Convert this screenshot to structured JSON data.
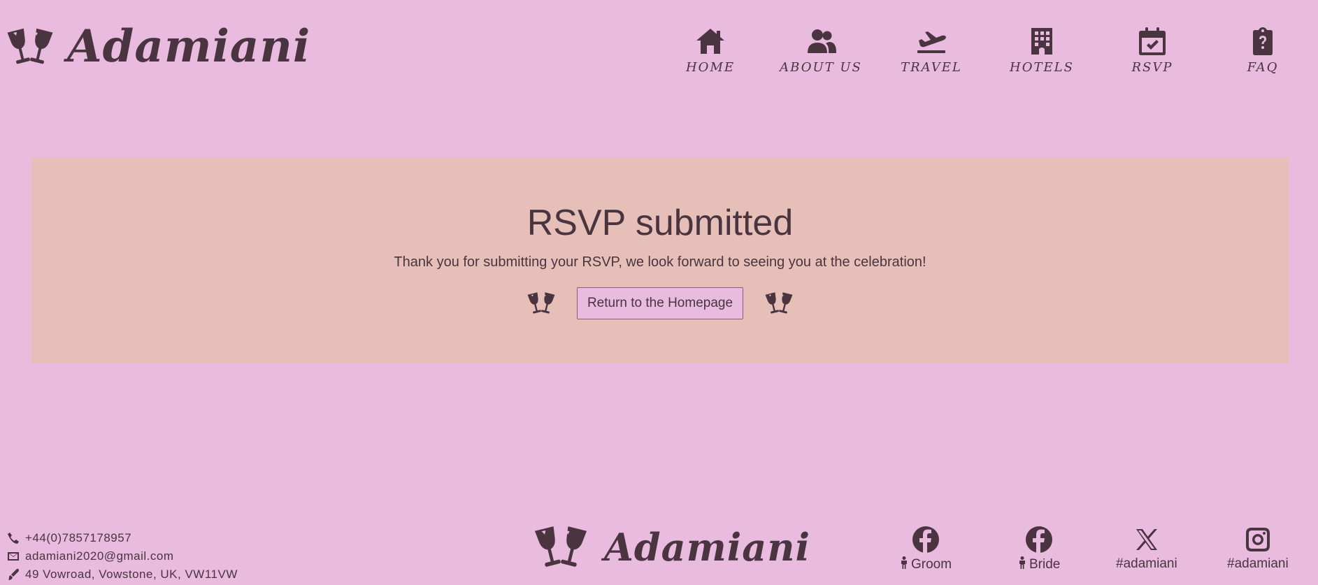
{
  "header": {
    "brand": "Adamiani",
    "nav": [
      {
        "label": "HOME",
        "icon": "home-icon"
      },
      {
        "label": "ABOUT US",
        "icon": "users-icon"
      },
      {
        "label": "TRAVEL",
        "icon": "plane-icon"
      },
      {
        "label": "HOTELS",
        "icon": "building-icon"
      },
      {
        "label": "RSVP",
        "icon": "calendar-check-icon"
      },
      {
        "label": "FAQ",
        "icon": "clipboard-question-icon"
      }
    ]
  },
  "main": {
    "title": "RSVP submitted",
    "message": "Thank you for submitting your RSVP, we look forward to seeing you at the celebration!",
    "button_label": "Return to the Homepage"
  },
  "footer": {
    "phone": "+44(0)7857178957",
    "email": "adamiani2020@gmail.com",
    "address": "49 Vowroad, Vowstone, UK, VW11VW",
    "brand": "Adamiani",
    "social": [
      {
        "label": "Groom",
        "icon": "facebook-icon"
      },
      {
        "label": "Bride",
        "icon": "facebook-icon"
      },
      {
        "label": "#adamiani",
        "icon": "x-icon"
      },
      {
        "label": "#adamiani",
        "icon": "instagram-icon"
      }
    ]
  },
  "colors": {
    "background": "#e8bbdf",
    "panel": "#e6c0b8",
    "text": "#4a3440"
  }
}
